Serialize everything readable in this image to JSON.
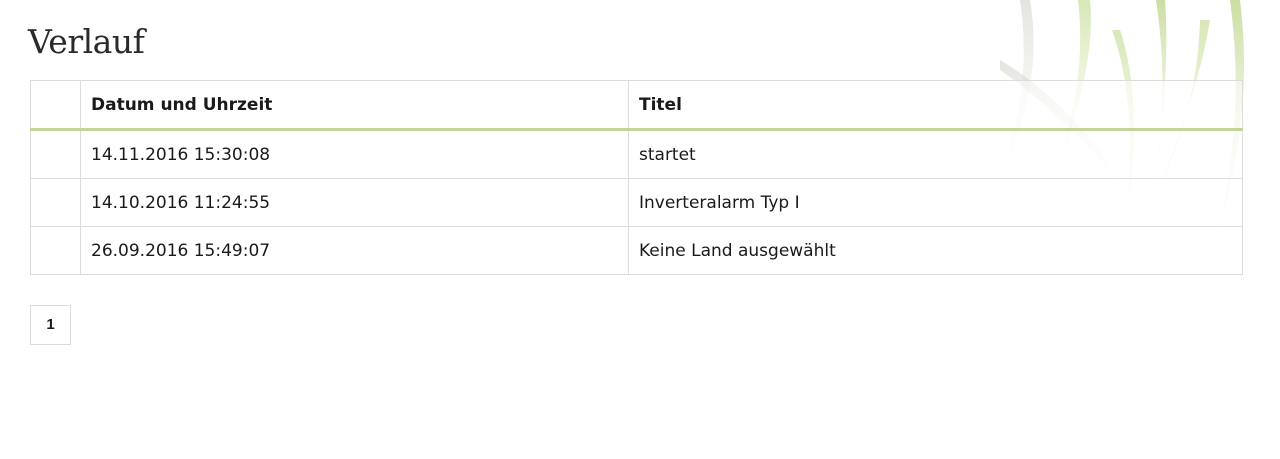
{
  "page": {
    "title": "Verlauf"
  },
  "table": {
    "headers": {
      "empty": "",
      "date": "Datum und Uhrzeit",
      "title": "Titel"
    },
    "rows": [
      {
        "date": "14.11.2016 15:30:08",
        "title": "startet"
      },
      {
        "date": "14.10.2016 11:24:55",
        "title": "Inverteralarm Typ I"
      },
      {
        "date": "26.09.2016 15:49:07",
        "title": "Keine Land ausgewählt"
      }
    ],
    "header_separator_color": "#c4d49a"
  },
  "pagination": {
    "pages": [
      "1"
    ],
    "current": "1"
  }
}
